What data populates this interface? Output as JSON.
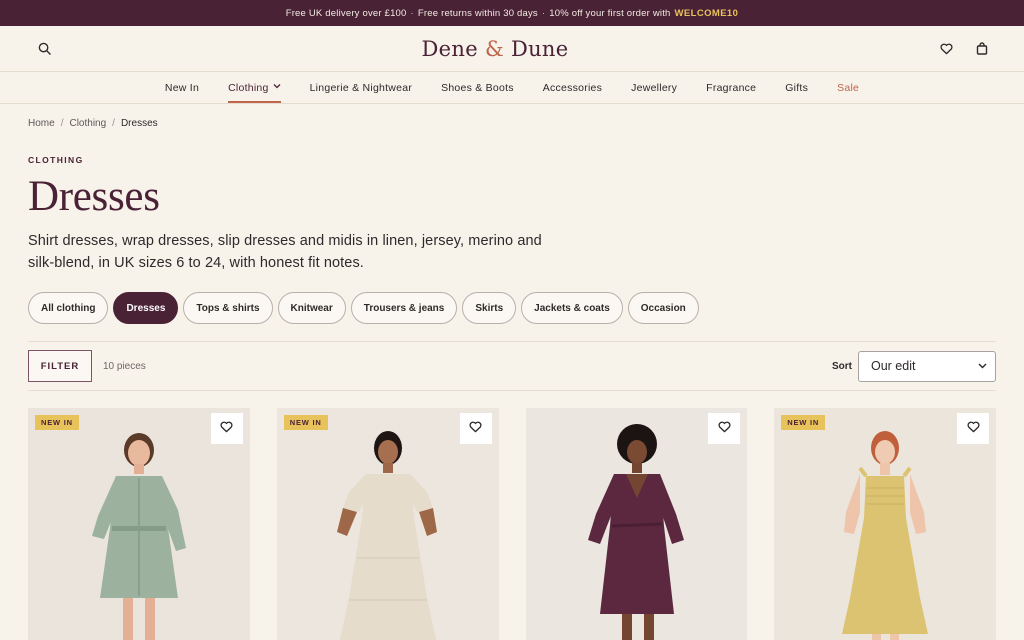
{
  "promo": {
    "part1": "Free UK delivery over £100",
    "sep1": "·",
    "part2": "Free returns within 30 days",
    "sep2": "·",
    "part3": "10% off your first order with",
    "code": "WELCOME10"
  },
  "header": {
    "brand_left": "Dene",
    "brand_amp": "&",
    "brand_right": "Dune",
    "icons": [
      "search-icon",
      "heart-icon",
      "bag-icon"
    ]
  },
  "nav": {
    "items": [
      {
        "label": "New In"
      },
      {
        "label": "Clothing",
        "chevron": "⌄"
      },
      {
        "label": "Lingerie & Nightwear"
      },
      {
        "label": "Shoes & Boots"
      },
      {
        "label": "Accessories"
      },
      {
        "label": "Jewellery"
      },
      {
        "label": "Fragrance"
      },
      {
        "label": "Gifts"
      },
      {
        "label": "Sale"
      }
    ]
  },
  "breadcrumb": {
    "items": [
      "Home",
      "Clothing",
      "Dresses"
    ],
    "separator": "/"
  },
  "page": {
    "eyebrow": "CLOTHING",
    "title": "Dresses",
    "description": "Shirt dresses, wrap dresses, slip dresses and midis in linen, jersey, merino and silk-blend, in UK sizes 6 to 24, with honest fit notes."
  },
  "chips": [
    {
      "label": "All clothing"
    },
    {
      "label": "Dresses",
      "active": true
    },
    {
      "label": "Tops & shirts"
    },
    {
      "label": "Knitwear"
    },
    {
      "label": "Trousers & jeans"
    },
    {
      "label": "Skirts"
    },
    {
      "label": "Jackets & coats"
    },
    {
      "label": "Occasion"
    }
  ],
  "toolbar": {
    "filter_label": "FILTER",
    "count": "10 pieces",
    "sort_label": "Sort",
    "sort_value": "Our edit"
  },
  "products": [
    {
      "badge": "NEW IN",
      "dress": "sage shirt dress"
    },
    {
      "badge": "NEW IN",
      "dress": "cream tiered dress"
    },
    {
      "badge": "",
      "dress": "plum wrap dress"
    },
    {
      "badge": "NEW IN",
      "dress": "yellow smocked dress"
    }
  ],
  "colors": {
    "brand": "#4a2236",
    "accent": "#c0654b",
    "badge": "#e8c25a",
    "background": "#f7f2ea"
  }
}
